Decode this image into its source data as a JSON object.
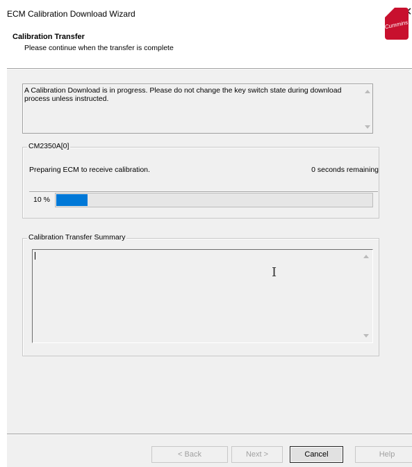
{
  "window": {
    "title": "ECM Calibration Download Wizard",
    "close_glyph": "✕"
  },
  "header": {
    "title": "Calibration Transfer",
    "subtitle": "Please continue when the transfer is complete",
    "logo_text": "Cummins"
  },
  "message": {
    "text": "A Calibration Download is in progress.  Please do not change the key switch state during download process unless instructed."
  },
  "device_group": {
    "legend": "CM2350A[0]",
    "status": "Preparing ECM to receive calibration.",
    "remaining": "0 seconds remaining",
    "progress_label": "10 %",
    "progress_percent": 10
  },
  "summary_group": {
    "legend": "Calibration Transfer Summary",
    "text": ""
  },
  "buttons": {
    "back": "< Back",
    "next": "Next >",
    "cancel": "Cancel",
    "help": "Help"
  },
  "colors": {
    "progress_fill": "#0078d7",
    "logo_red": "#c8102e",
    "panel_bg": "#f0f0f0"
  }
}
